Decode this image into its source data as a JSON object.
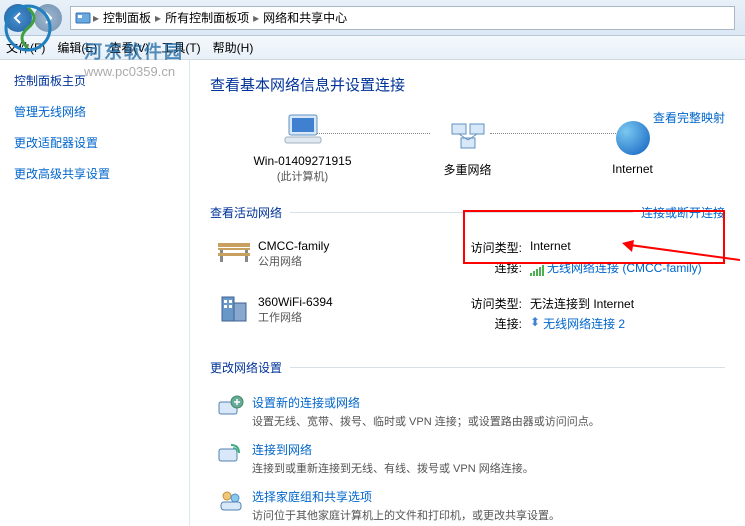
{
  "nav": {
    "breadcrumb": [
      "控制面板",
      "所有控制面板项",
      "网络和共享中心"
    ]
  },
  "menu": {
    "file": "文件(F)",
    "edit": "编辑(E)",
    "view": "查看(V)",
    "tools": "工具(T)",
    "help": "帮助(H)"
  },
  "sidebar": {
    "title": "控制面板主页",
    "links": [
      "管理无线网络",
      "更改适配器设置",
      "更改高级共享设置"
    ]
  },
  "main": {
    "title": "查看基本网络信息并设置连接",
    "full_map": "查看完整映射",
    "map": {
      "pc": {
        "name": "Win-01409271915",
        "sub": "(此计算机)"
      },
      "mid": {
        "name": "多重网络"
      },
      "net": {
        "name": "Internet"
      }
    },
    "active_head": "查看活动网络",
    "active_link": "连接或断开连接",
    "net1": {
      "name": "CMCC-family",
      "type": "公用网络",
      "access_label": "访问类型:",
      "access_val": "Internet",
      "conn_label": "连接:",
      "conn_val": "无线网络连接 (CMCC-family)"
    },
    "net2": {
      "name": "360WiFi-6394",
      "type": "工作网络",
      "access_label": "访问类型:",
      "access_val": "无法连接到 Internet",
      "conn_label": "连接:",
      "conn_val": "无线网络连接 2"
    },
    "change_head": "更改网络设置",
    "setting1": {
      "link": "设置新的连接或网络",
      "desc": "设置无线、宽带、拨号、临时或 VPN 连接；或设置路由器或访问问点。"
    },
    "setting2": {
      "link": "连接到网络",
      "desc": "连接到或重新连接到无线、有线、拨号或 VPN 网络连接。"
    },
    "setting3": {
      "link": "选择家庭组和共享选项",
      "desc": "访问位于其他家庭计算机上的文件和打印机，或更改共享设置。"
    }
  },
  "overlay": {
    "site": "河东软件园",
    "watermark": "www.pc0359.cn"
  }
}
